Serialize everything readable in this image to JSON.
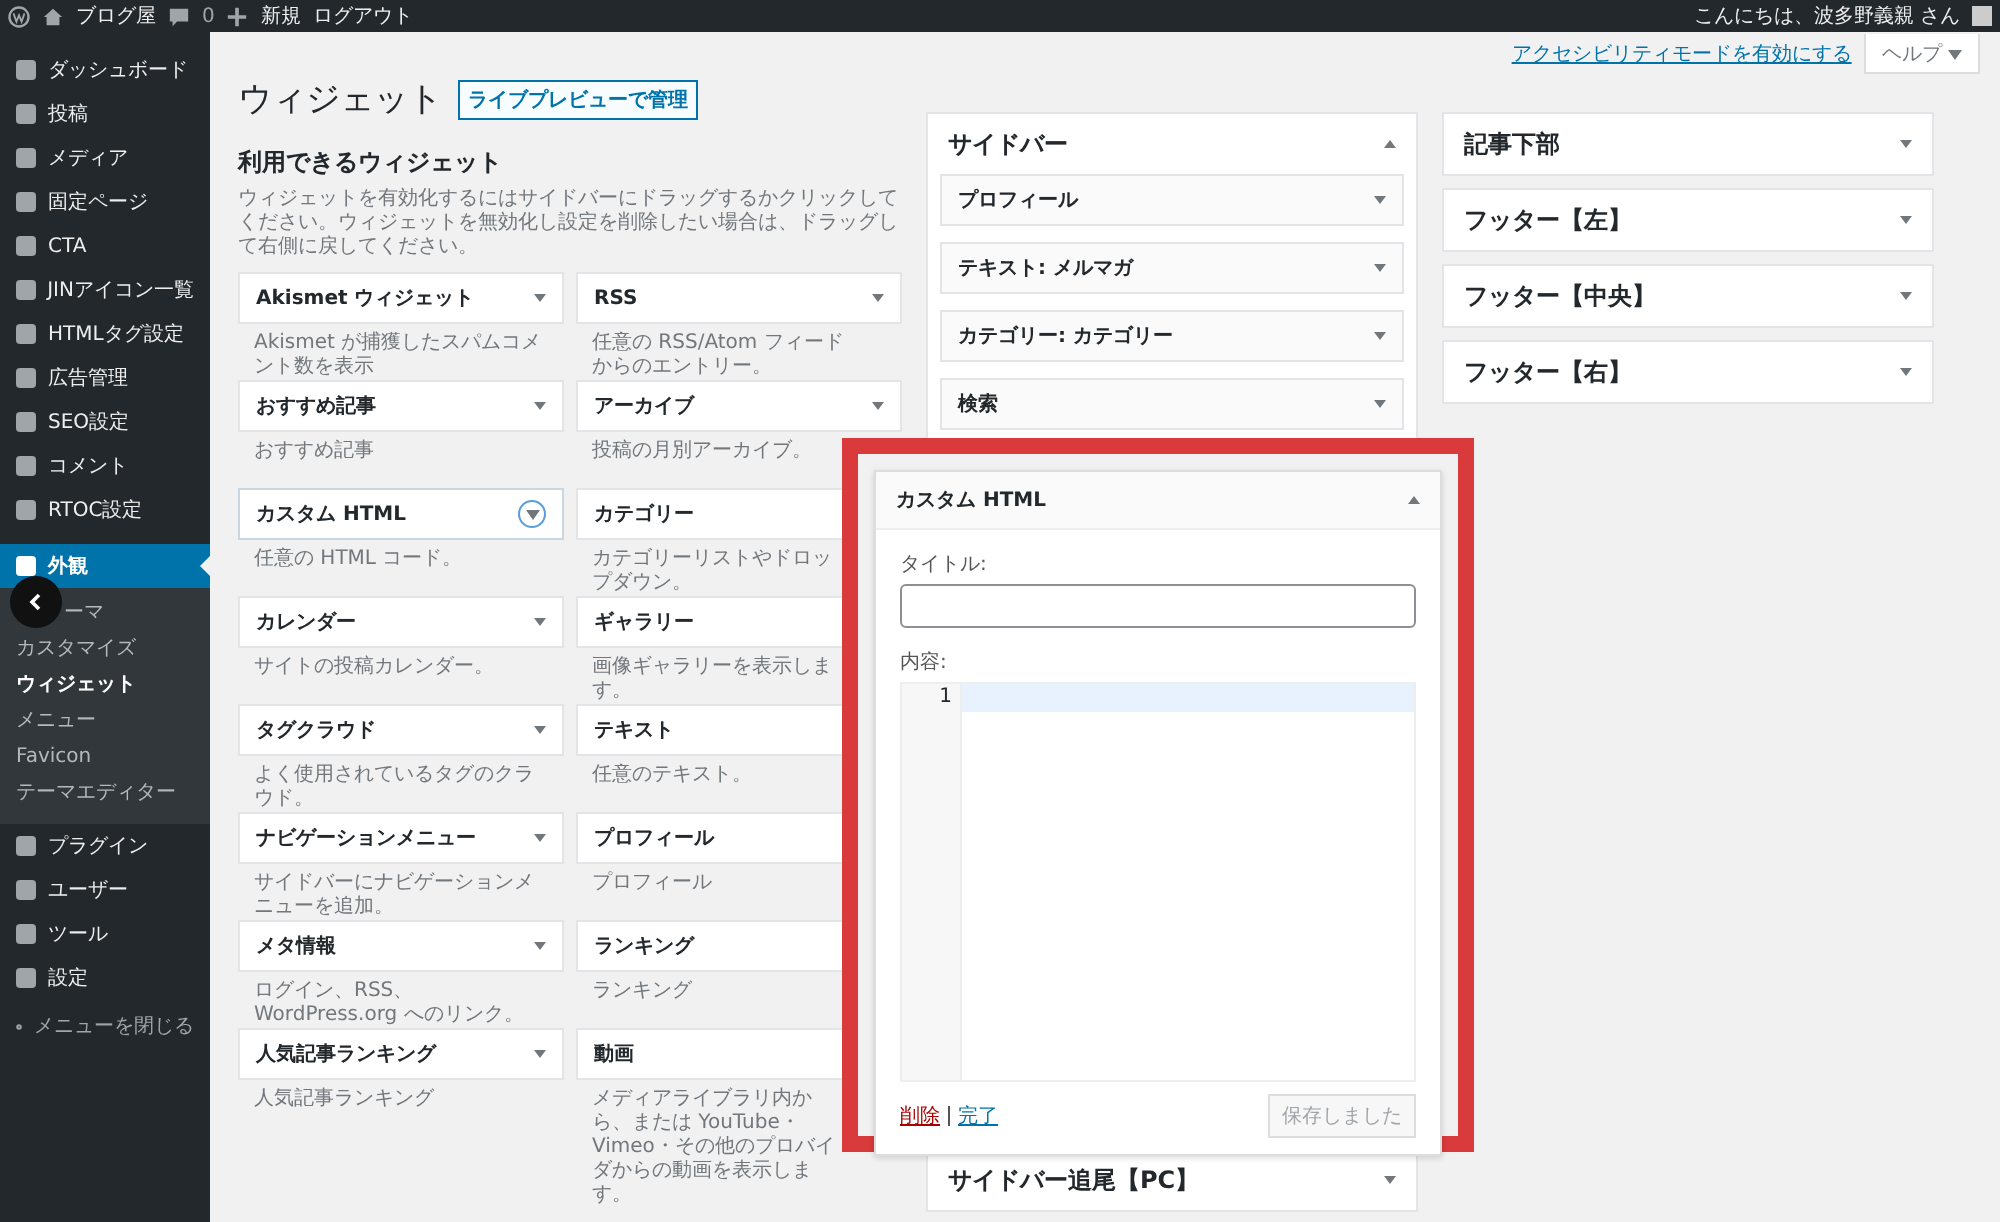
{
  "admin_bar": {
    "site": "ブログ屋",
    "comments": "0",
    "new": "新規",
    "logout": "ログアウト",
    "greeting": "こんにちは、波多野義親 さん"
  },
  "menu": [
    {
      "label": "ダッシュボード",
      "selected": false
    },
    {
      "label": "投稿",
      "selected": false
    },
    {
      "label": "メディア",
      "selected": false
    },
    {
      "label": "固定ページ",
      "selected": false
    },
    {
      "label": "CTA",
      "selected": false
    },
    {
      "label": "JINアイコン一覧",
      "selected": false
    },
    {
      "label": "HTMLタグ設定",
      "selected": false
    },
    {
      "label": "広告管理",
      "selected": false
    },
    {
      "label": "SEO設定",
      "selected": false
    },
    {
      "label": "コメント",
      "selected": false
    },
    {
      "label": "RTOC設定",
      "selected": false
    },
    {
      "label": "外観",
      "selected": true,
      "submenu": [
        {
          "label": "ーマ",
          "selected": false
        },
        {
          "label": "カスタマイズ",
          "selected": false
        },
        {
          "label": "ウィジェット",
          "selected": true
        },
        {
          "label": "メニュー",
          "selected": false
        },
        {
          "label": "Favicon",
          "selected": false
        },
        {
          "label": "テーマエディター",
          "selected": false
        }
      ]
    },
    {
      "label": "プラグイン",
      "selected": false
    },
    {
      "label": "ユーザー",
      "selected": false
    },
    {
      "label": "ツール",
      "selected": false
    },
    {
      "label": "設定",
      "selected": false
    }
  ],
  "collapse_menu": "メニューを閉じる",
  "screen_links": {
    "accessibility": "アクセシビリティモードを有効にする",
    "help": "ヘルプ"
  },
  "page": {
    "title": "ウィジェット",
    "action": "ライブプレビューで管理"
  },
  "available": {
    "heading": "利用できるウィジェット",
    "description": "ウィジェットを有効化するにはサイドバーにドラッグするかクリックしてください。ウィジェットを無効化し設定を削除したい場合は、ドラッグして右側に戻してください。",
    "widgets": [
      {
        "name": "Akismet ウィジェット",
        "description": "Akismet が捕獲したスパムコメント数を表示",
        "focused": false
      },
      {
        "name": "RSS",
        "description": "任意の RSS/Atom フィードからのエントリー。",
        "focused": false
      },
      {
        "name": "おすすめ記事",
        "description": "おすすめ記事",
        "focused": false
      },
      {
        "name": "アーカイブ",
        "description": "投稿の月別アーカイブ。",
        "focused": false
      },
      {
        "name": "カスタム HTML",
        "description": "任意の HTML コード。",
        "focused": true
      },
      {
        "name": "カテゴリー",
        "description": "カテゴリーリストやドロップダウン。",
        "focused": false
      },
      {
        "name": "カレンダー",
        "description": "サイトの投稿カレンダー。",
        "focused": false
      },
      {
        "name": "ギャラリー",
        "description": "画像ギャラリーを表示します。",
        "focused": false
      },
      {
        "name": "タグクラウド",
        "description": "よく使用されているタグのクラウド。",
        "focused": false
      },
      {
        "name": "テキスト",
        "description": "任意のテキスト。",
        "focused": false
      },
      {
        "name": "ナビゲーションメニュー",
        "description": "サイドバーにナビゲーションメニューを追加。",
        "focused": false
      },
      {
        "name": "プロフィール",
        "description": "プロフィール",
        "focused": false
      },
      {
        "name": "メタ情報",
        "description": "ログイン、RSS、WordPress.org へのリンク。",
        "focused": false
      },
      {
        "name": "ランキング",
        "description": "ランキング",
        "focused": false
      },
      {
        "name": "人気記事ランキング",
        "description": "人気記事ランキング",
        "focused": false
      },
      {
        "name": "動画",
        "description": "メディアライブラリ内から、または YouTube・Vimeo・その他のプロバイダからの動画を表示します。",
        "focused": false
      }
    ]
  },
  "areas_left": [
    {
      "name": "サイドバー",
      "expanded": true,
      "widgets": [
        "プロフィール",
        "テキスト: メルマガ",
        "カテゴリー: カテゴリー",
        "検索"
      ]
    },
    {
      "name": "サイドバー追尾【PC】",
      "expanded": false
    }
  ],
  "areas_right": [
    {
      "name": "記事下部",
      "expanded": false
    },
    {
      "name": "フッター【左】",
      "expanded": false
    },
    {
      "name": "フッター【中央】",
      "expanded": false
    },
    {
      "name": "フッター【右】",
      "expanded": false
    }
  ],
  "dragged": {
    "name": "カスタム HTML",
    "expanded": true,
    "title_label": "タイトル:",
    "content_label": "内容:",
    "line_number": "1",
    "delete": "削除",
    "done": "完了",
    "save": "保存しました",
    "save_disabled": true
  }
}
